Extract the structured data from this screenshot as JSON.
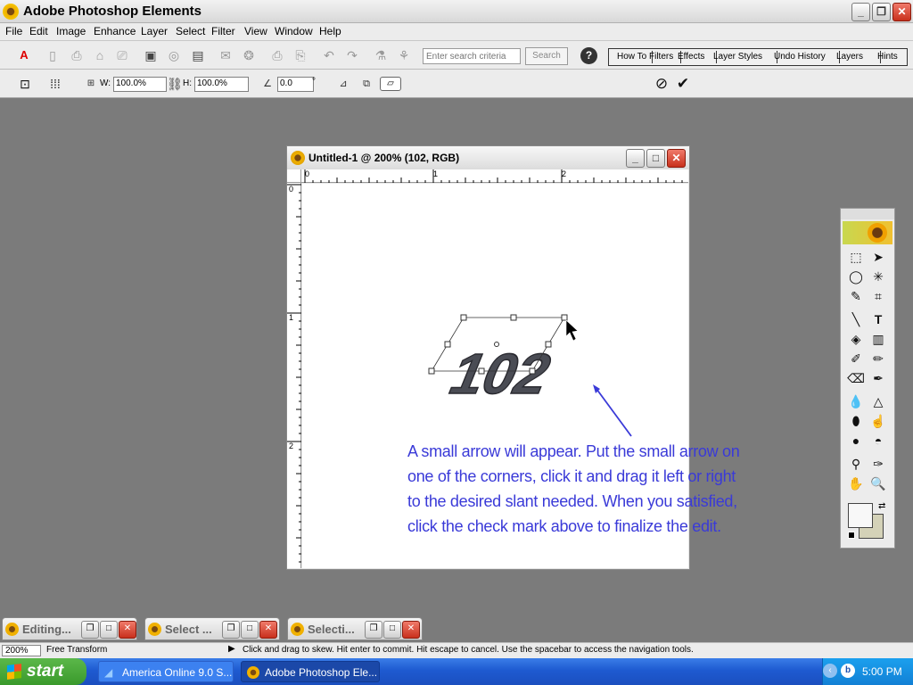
{
  "app": {
    "title": "Adobe Photoshop Elements"
  },
  "menu": [
    "File",
    "Edit",
    "Image",
    "Enhance",
    "Layer",
    "Select",
    "Filter",
    "View",
    "Window",
    "Help"
  ],
  "toolbar": {
    "search_placeholder": "Enter search criteria",
    "search_label": "Search",
    "help_glyph": "?"
  },
  "palette_well": {
    "tabs": [
      "How To",
      "Filters",
      "Effects",
      "Layer Styles",
      "Undo History",
      "Layers",
      "Hints"
    ]
  },
  "options": {
    "w_label": "W:",
    "w_value": "100.0%",
    "h_label": "H:",
    "h_value": "100.0%",
    "angle_value": "0.0",
    "degree": "°"
  },
  "document": {
    "title": "Untitled-1 @ 200% (102, RGB)",
    "text": "102",
    "ruler_top": [
      "0",
      "1",
      "2"
    ],
    "ruler_left": [
      "0",
      "1",
      "2"
    ]
  },
  "instructions": [
    "A small arrow will appear.  Put the small arrow on",
    "one of the corners, click it and drag it left or right",
    "to the desired slant needed.  When you satisfied,",
    "click the check mark above to finalize the edit."
  ],
  "bins": [
    {
      "label": "Editing..."
    },
    {
      "label": "Select ..."
    },
    {
      "label": "Selecti..."
    }
  ],
  "status": {
    "zoom": "200%",
    "mode": "Free Transform",
    "hint": "Click and drag to skew. Hit enter to commit. Hit escape to cancel. Use the spacebar to access the navigation tools."
  },
  "taskbar": {
    "start": "start",
    "tasks": [
      "America Online 9.0 S...",
      "Adobe Photoshop Ele..."
    ],
    "clock": "5:00 PM"
  },
  "colors": {
    "instruction_text": "#3a3ad8",
    "taskbar": "#1e5ad0",
    "start": "#3a9a2c"
  }
}
